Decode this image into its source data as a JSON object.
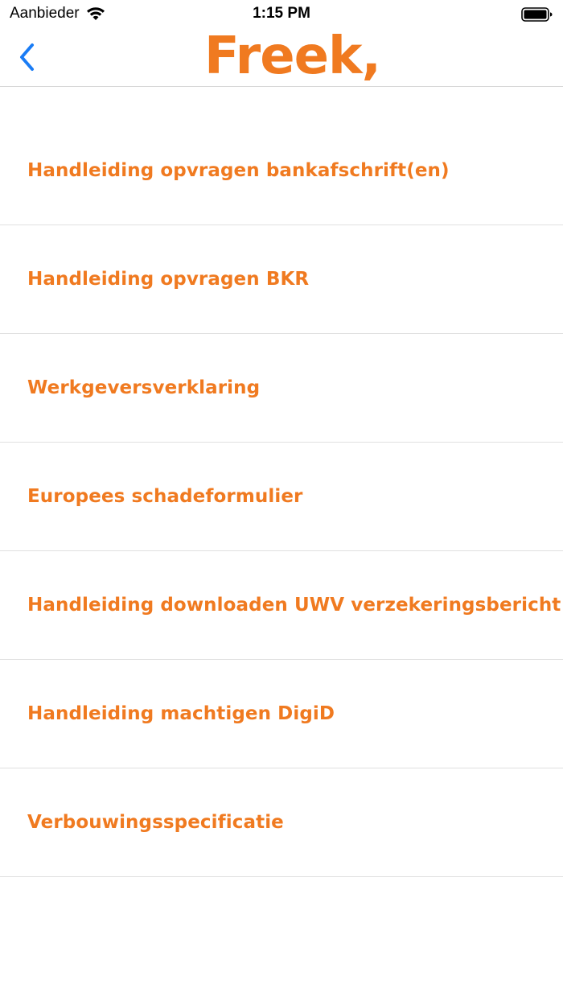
{
  "status_bar": {
    "carrier": "Aanbieder",
    "time": "1:15 PM",
    "icons": [
      "wifi-icon",
      "battery-icon"
    ]
  },
  "nav": {
    "back_icon": "chevron-left-icon",
    "logo_text": "Freek,",
    "accent_color": "#f07a20",
    "back_color": "#1a7cf5"
  },
  "documents": [
    {
      "label": "Handleiding opvragen bankafschrift(en)"
    },
    {
      "label": "Handleiding opvragen BKR"
    },
    {
      "label": "Werkgeversverklaring"
    },
    {
      "label": "Europees schadeformulier"
    },
    {
      "label": "Handleiding downloaden UWV verzekeringsbericht"
    },
    {
      "label": "Handleiding machtigen DigiD"
    },
    {
      "label": "Verbouwingsspecificatie"
    }
  ]
}
